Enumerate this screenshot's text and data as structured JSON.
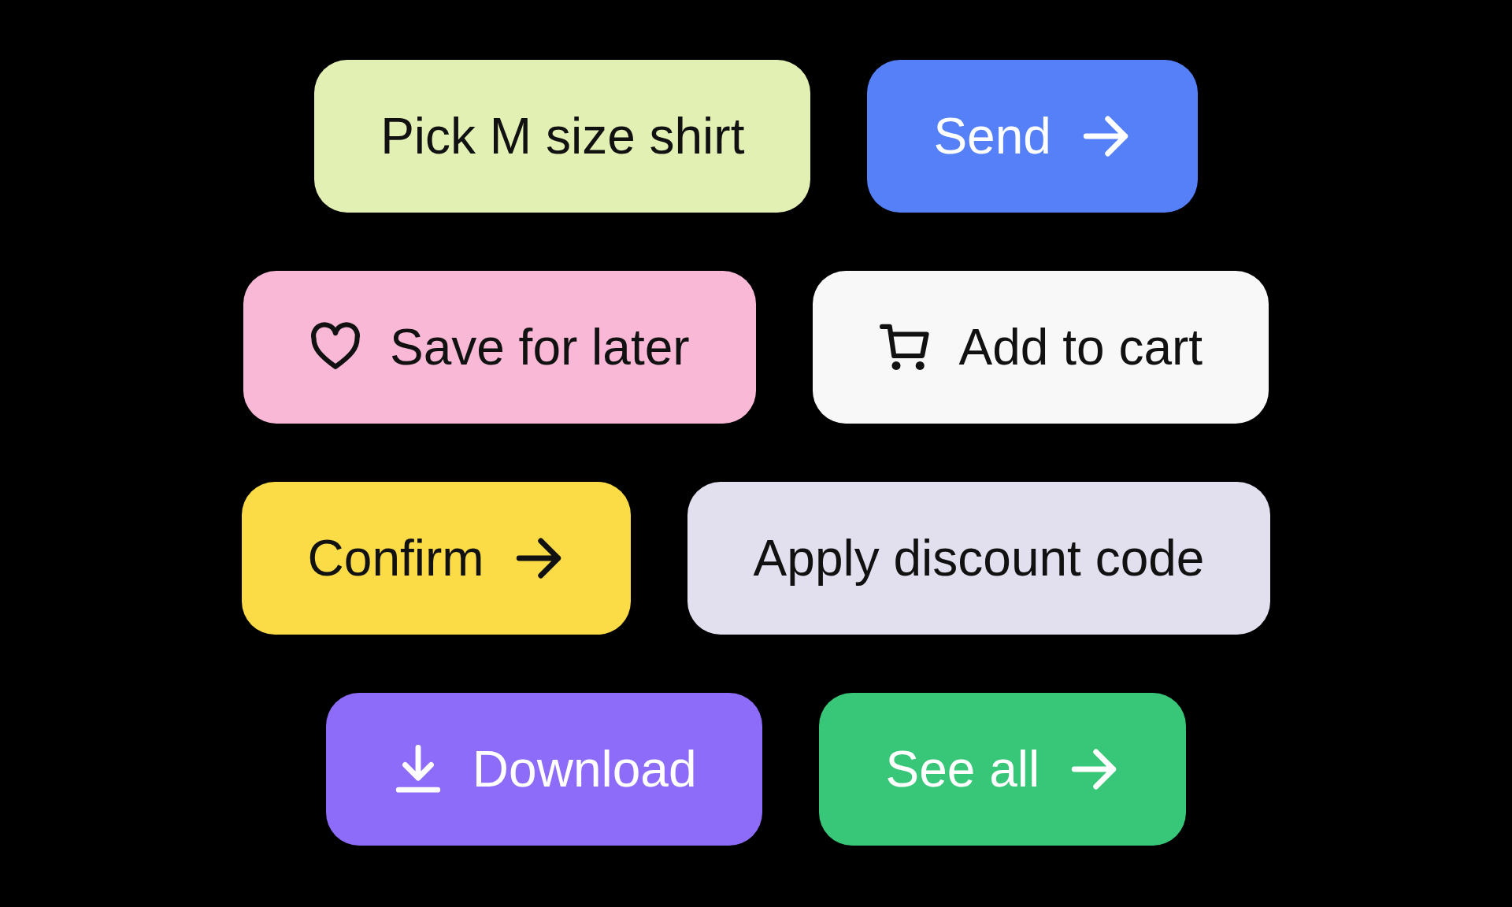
{
  "rows": [
    [
      {
        "label": "Pick M size shirt",
        "color": "#e3f0b4",
        "kind": "plain"
      },
      {
        "label": "Send",
        "color": "#5580f7",
        "kind": "arrow"
      }
    ],
    [
      {
        "label": "Save for later",
        "color": "#f9b8d6",
        "kind": "heart"
      },
      {
        "label": "Add to cart",
        "color": "#f8f8f8",
        "kind": "cart"
      }
    ],
    [
      {
        "label": "Confirm",
        "color": "#fcdc46",
        "kind": "arrow"
      },
      {
        "label": "Apply discount code",
        "color": "#e2e0ef",
        "kind": "plain"
      }
    ],
    [
      {
        "label": "Download",
        "color": "#8c6cf8",
        "kind": "download"
      },
      {
        "label": "See all",
        "color": "#38c778",
        "kind": "arrow"
      }
    ]
  ]
}
